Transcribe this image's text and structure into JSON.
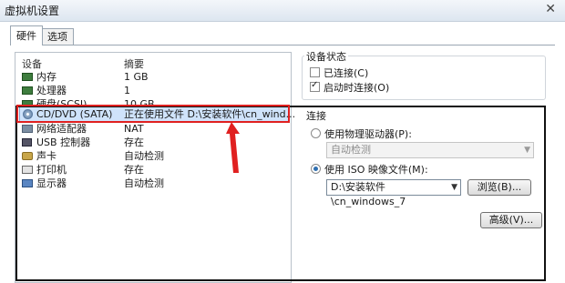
{
  "window": {
    "title": "虚拟机设置",
    "close_glyph": "✕"
  },
  "tabs": [
    {
      "label": "硬件",
      "active": true
    },
    {
      "label": "选项",
      "active": false
    }
  ],
  "device_list": {
    "header_device": "设备",
    "header_summary": "摘要",
    "rows": [
      {
        "name": "内存",
        "summary": "1 GB",
        "icon": "memory-icon"
      },
      {
        "name": "处理器",
        "summary": "1",
        "icon": "processor-icon"
      },
      {
        "name": "硬盘(SCSI)",
        "summary": "10 GB",
        "icon": "hard-disk-icon"
      },
      {
        "name": "CD/DVD (SATA)",
        "summary": "正在使用文件 D:\\安装软件\\cn_wind...",
        "icon": "cd-dvd-icon",
        "selected": true
      },
      {
        "name": "网络适配器",
        "summary": "NAT",
        "icon": "network-adapter-icon"
      },
      {
        "name": "USB 控制器",
        "summary": "存在",
        "icon": "usb-controller-icon"
      },
      {
        "name": "声卡",
        "summary": "自动检测",
        "icon": "sound-card-icon"
      },
      {
        "name": "打印机",
        "summary": "存在",
        "icon": "printer-icon"
      },
      {
        "name": "显示器",
        "summary": "自动检测",
        "icon": "display-icon"
      }
    ]
  },
  "device_status": {
    "group_label": "设备状态",
    "connected_label": "已连接(C)",
    "connected_checked": false,
    "connect_at_power_on_label": "启动时连接(O)",
    "connect_at_power_on_checked": true
  },
  "connection": {
    "group_label": "连接",
    "physical_drive_label": "使用物理驱动器(P):",
    "physical_drive_selected": false,
    "physical_drive_value": "自动检测",
    "iso_label": "使用 ISO 映像文件(M):",
    "iso_selected": true,
    "iso_path": "D:\\安装软件\\cn_windows_7",
    "browse_label": "浏览(B)...",
    "advanced_label": "高级(V)..."
  },
  "annotations": {
    "red": "#e02020",
    "black": "#111111"
  }
}
